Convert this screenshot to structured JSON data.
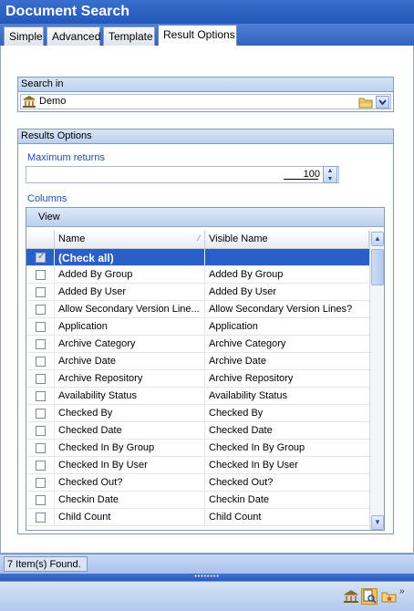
{
  "window": {
    "title": "Document Search"
  },
  "tabs": [
    {
      "label": "Simple"
    },
    {
      "label": "Advanced"
    },
    {
      "label": "Template"
    },
    {
      "label": "Result Options"
    }
  ],
  "active_tab": "Result Options",
  "search_in": {
    "header": "Search in",
    "value": "Demo",
    "icon": "bank-icon",
    "browse_icon": "folder-icon",
    "dropdown_icon": "chevron-down-icon"
  },
  "results_options": {
    "header": "Results Options",
    "max_returns_label": "Maximum returns",
    "max_returns_value": "100",
    "columns_label": "Columns",
    "view_label": "View",
    "column_headers": [
      "Name",
      "Visible Name"
    ],
    "rows": [
      {
        "name": "(Check all)",
        "visible": "",
        "checked": true,
        "selected": true
      },
      {
        "name": "Added By Group",
        "visible": "Added By Group",
        "checked": false
      },
      {
        "name": "Added By User",
        "visible": "Added By User",
        "checked": false
      },
      {
        "name": "Allow Secondary Version Line...",
        "visible": "Allow Secondary Version Lines?",
        "checked": false
      },
      {
        "name": "Application",
        "visible": "Application",
        "checked": false
      },
      {
        "name": "Archive Category",
        "visible": "Archive Category",
        "checked": false
      },
      {
        "name": "Archive Date",
        "visible": "Archive Date",
        "checked": false
      },
      {
        "name": "Archive Repository",
        "visible": "Archive Repository",
        "checked": false
      },
      {
        "name": "Availability Status",
        "visible": "Availability Status",
        "checked": false
      },
      {
        "name": "Checked By",
        "visible": "Checked By",
        "checked": false
      },
      {
        "name": "Checked Date",
        "visible": "Checked Date",
        "checked": false
      },
      {
        "name": "Checked In By Group",
        "visible": "Checked In By Group",
        "checked": false
      },
      {
        "name": "Checked In By User",
        "visible": "Checked In By User",
        "checked": false
      },
      {
        "name": "Checked Out?",
        "visible": "Checked Out?",
        "checked": false
      },
      {
        "name": "Checkin Date",
        "visible": "Checkin Date",
        "checked": false
      },
      {
        "name": "Child Count",
        "visible": "Child Count",
        "checked": false
      }
    ]
  },
  "status": {
    "text": "7 Item(s) Found."
  },
  "bottom_toolbar": {
    "icons": [
      "bank-icon",
      "document-search-icon",
      "folder-star-icon"
    ],
    "active_icon": "document-search-icon",
    "overflow_icon": "double-chevron-down-icon"
  }
}
